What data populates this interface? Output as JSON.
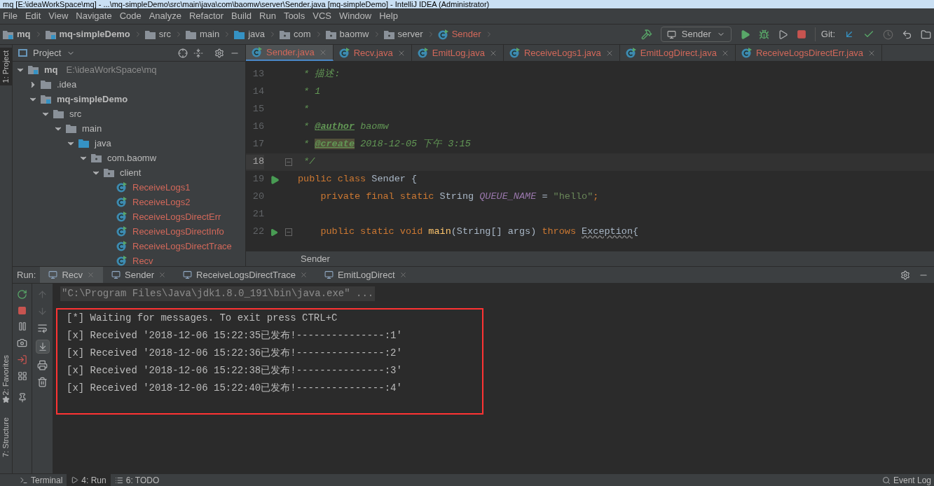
{
  "window": {
    "title": "mq [E:\\ideaWorkSpace\\mq] - ...\\mq-simpleDemo\\src\\main\\java\\com\\baomw\\server\\Sender.java [mq-simpleDemo] - IntelliJ IDEA (Administrator)"
  },
  "menu": [
    "File",
    "Edit",
    "View",
    "Navigate",
    "Code",
    "Analyze",
    "Refactor",
    "Build",
    "Run",
    "Tools",
    "VCS",
    "Window",
    "Help"
  ],
  "breadcrumb": [
    {
      "label": "mq",
      "kind": "module"
    },
    {
      "label": "mq-simpleDemo",
      "kind": "module"
    },
    {
      "label": "src",
      "kind": "folder"
    },
    {
      "label": "main",
      "kind": "folder"
    },
    {
      "label": "java",
      "kind": "source"
    },
    {
      "label": "com",
      "kind": "package"
    },
    {
      "label": "baomw",
      "kind": "package"
    },
    {
      "label": "server",
      "kind": "package"
    },
    {
      "label": "Sender",
      "kind": "class"
    }
  ],
  "toolbar": {
    "run_config": "Sender",
    "git_label": "Git:"
  },
  "side_tools": {
    "left_top": "1: Project",
    "left_middle": "2: Favorites",
    "left_bottom": "7: Structure"
  },
  "project": {
    "title": "Project",
    "tree": [
      {
        "label": "mq",
        "path": "E:\\ideaWorkSpace\\mq",
        "kind": "module",
        "expanded": true,
        "children": [
          {
            "label": ".idea",
            "kind": "folder",
            "expanded": false
          },
          {
            "label": "mq-simpleDemo",
            "kind": "module",
            "expanded": true,
            "children": [
              {
                "label": "src",
                "kind": "folder",
                "expanded": true,
                "children": [
                  {
                    "label": "main",
                    "kind": "folder",
                    "expanded": true,
                    "children": [
                      {
                        "label": "java",
                        "kind": "source",
                        "expanded": true,
                        "children": [
                          {
                            "label": "com.baomw",
                            "kind": "package",
                            "expanded": true,
                            "children": [
                              {
                                "label": "client",
                                "kind": "package",
                                "expanded": true,
                                "children": [
                                  {
                                    "label": "ReceiveLogs1",
                                    "kind": "class"
                                  },
                                  {
                                    "label": "ReceiveLogs2",
                                    "kind": "class"
                                  },
                                  {
                                    "label": "ReceiveLogsDirectErr",
                                    "kind": "class"
                                  },
                                  {
                                    "label": "ReceiveLogsDirectInfo",
                                    "kind": "class"
                                  },
                                  {
                                    "label": "ReceiveLogsDirectTrace",
                                    "kind": "class"
                                  },
                                  {
                                    "label": "Recv",
                                    "kind": "class"
                                  }
                                ]
                              }
                            ]
                          }
                        ]
                      }
                    ]
                  }
                ]
              }
            ]
          }
        ]
      }
    ]
  },
  "editor_tabs": [
    {
      "label": "Sender.java",
      "selected": true
    },
    {
      "label": "Recv.java",
      "selected": false
    },
    {
      "label": "EmitLog.java",
      "selected": false
    },
    {
      "label": "ReceiveLogs1.java",
      "selected": false
    },
    {
      "label": "EmitLogDirect.java",
      "selected": false
    },
    {
      "label": "ReceiveLogsDirectErr.java",
      "selected": false
    }
  ],
  "code": [
    {
      "number": "13",
      "run": false,
      "fold": false,
      "current": false,
      "tokens": [
        {
          "text": " * 描述:",
          "kind": "doc"
        }
      ]
    },
    {
      "number": "14",
      "run": false,
      "fold": false,
      "current": false,
      "tokens": [
        {
          "text": " * 1",
          "kind": "doc"
        }
      ]
    },
    {
      "number": "15",
      "run": false,
      "fold": false,
      "current": false,
      "tokens": [
        {
          "text": " *",
          "kind": "doc"
        }
      ]
    },
    {
      "number": "16",
      "run": false,
      "fold": false,
      "current": false,
      "tokens": [
        {
          "text": " * ",
          "kind": "doc"
        },
        {
          "text": "@author",
          "kind": "doctag"
        },
        {
          "text": " baomw",
          "kind": "doc"
        }
      ]
    },
    {
      "number": "17",
      "run": false,
      "fold": false,
      "current": false,
      "tokens": [
        {
          "text": " * ",
          "kind": "doc"
        },
        {
          "text": "@create",
          "kind": "doctag_hl"
        },
        {
          "text": " 2018-12-05 下午 3:15",
          "kind": "doc"
        }
      ]
    },
    {
      "number": "18",
      "run": false,
      "fold": true,
      "current": true,
      "tokens": [
        {
          "text": " */",
          "kind": "doc"
        }
      ]
    },
    {
      "number": "19",
      "run": true,
      "fold": false,
      "current": false,
      "tokens": [
        {
          "text": "public class ",
          "kind": "keyword"
        },
        {
          "text": "Sender {",
          "kind": "plain"
        }
      ]
    },
    {
      "number": "20",
      "run": false,
      "fold": false,
      "current": false,
      "tokens": [
        {
          "text": "    private final static ",
          "kind": "keyword"
        },
        {
          "text": "String ",
          "kind": "plain"
        },
        {
          "text": "QUEUE_NAME",
          "kind": "constant"
        },
        {
          "text": " = ",
          "kind": "plain"
        },
        {
          "text": "\"hello\"",
          "kind": "string"
        },
        {
          "text": ";",
          "kind": "keyword"
        }
      ]
    },
    {
      "number": "21",
      "run": false,
      "fold": false,
      "current": false
    },
    {
      "number": "22",
      "run": true,
      "fold": true,
      "current": false,
      "tokens": [
        {
          "text": "    public static void ",
          "kind": "keyword"
        },
        {
          "text": "main",
          "kind": "method"
        },
        {
          "text": "(String[] args) ",
          "kind": "plain"
        },
        {
          "text": "throws ",
          "kind": "keyword"
        },
        {
          "text": "Exception",
          "kind": "warn"
        },
        {
          "text": "{",
          "kind": "plain"
        }
      ]
    }
  ],
  "editor_breadcrumb": "Sender",
  "run": {
    "label": "Run:",
    "tabs": [
      {
        "label": "Recv",
        "selected": true
      },
      {
        "label": "Sender",
        "selected": false
      },
      {
        "label": "ReceiveLogsDirectTrace",
        "selected": false
      },
      {
        "label": "EmitLogDirect",
        "selected": false
      }
    ],
    "command": "\"C:\\Program Files\\Java\\jdk1.8.0_191\\bin\\java.exe\" ...",
    "output": [
      "[*] Waiting for messages. To exit press CTRL+C",
      "[x] Received '2018-12-06 15:22:35已发布!---------------:1'",
      "[x] Received '2018-12-06 15:22:36已发布!---------------:2'",
      "[x] Received '2018-12-06 15:22:38已发布!---------------:3'",
      "[x] Received '2018-12-06 15:22:40已发布!---------------:4'"
    ]
  },
  "status_tabs": [
    {
      "label": "Terminal",
      "selected": false
    },
    {
      "label": "4: Run",
      "selected": true
    },
    {
      "label": "6: TODO",
      "selected": false
    }
  ],
  "event_log": "Event Log"
}
